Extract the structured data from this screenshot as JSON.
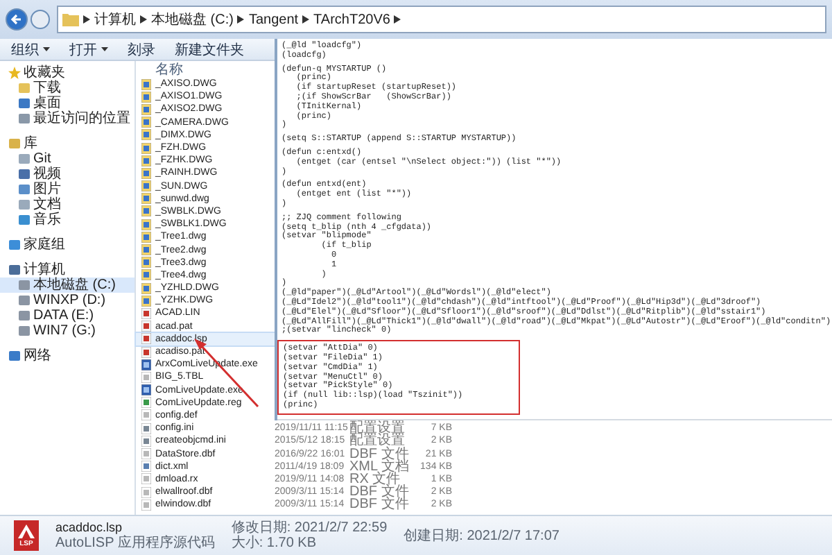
{
  "address": {
    "crumbs": [
      "计算机",
      "本地磁盘 (C:)",
      "Tangent",
      "TArchT20V6"
    ]
  },
  "toolbar": [
    {
      "label": "组织",
      "dropdown": true
    },
    {
      "label": "打开",
      "dropdown": true
    },
    {
      "label": "刻录",
      "dropdown": false
    },
    {
      "label": "新建文件夹",
      "dropdown": false
    }
  ],
  "nav": [
    {
      "label": "收藏夹",
      "kind": "star",
      "selected": false,
      "children": [
        {
          "label": "下载",
          "kind": "folder",
          "selected": false
        },
        {
          "label": "桌面",
          "kind": "screen",
          "selected": false
        },
        {
          "label": "最近访问的位置",
          "kind": "recent",
          "selected": false
        }
      ]
    },
    {
      "label": "库",
      "kind": "library",
      "selected": false,
      "children": [
        {
          "label": "Git",
          "kind": "document",
          "selected": false
        },
        {
          "label": "视频",
          "kind": "video",
          "selected": false
        },
        {
          "label": "图片",
          "kind": "picture",
          "selected": false
        },
        {
          "label": "文档",
          "kind": "document",
          "selected": false
        },
        {
          "label": "音乐",
          "kind": "music",
          "selected": false
        }
      ]
    },
    {
      "label": "家庭组",
      "kind": "people",
      "selected": false
    },
    {
      "label": "计算机",
      "kind": "computer",
      "selected": false,
      "children": [
        {
          "label": "本地磁盘 (C:)",
          "kind": "drive",
          "selected": true
        },
        {
          "label": "WINXP (D:)",
          "kind": "drive",
          "selected": false
        },
        {
          "label": "DATA (E:)",
          "kind": "drive",
          "selected": false
        },
        {
          "label": "WIN7 (G:)",
          "kind": "drive",
          "selected": false
        }
      ]
    },
    {
      "label": "网络",
      "kind": "network",
      "selected": false
    }
  ],
  "file_list": {
    "columns": [
      "名称"
    ],
    "rows": [
      {
        "name": "_AXISO.DWG",
        "kind": "drawing",
        "selected": false
      },
      {
        "name": "_AXISO1.DWG",
        "kind": "drawing",
        "selected": false
      },
      {
        "name": "_AXISO2.DWG",
        "kind": "drawing",
        "selected": false
      },
      {
        "name": "_CAMERA.DWG",
        "kind": "drawing",
        "selected": false
      },
      {
        "name": "_DIMX.DWG",
        "kind": "drawing",
        "selected": false
      },
      {
        "name": "_FZH.DWG",
        "kind": "drawing",
        "selected": false
      },
      {
        "name": "_FZHK.DWG",
        "kind": "drawing",
        "selected": false
      },
      {
        "name": "_RAINH.DWG",
        "kind": "drawing",
        "selected": false
      },
      {
        "name": "_SUN.DWG",
        "kind": "drawing",
        "selected": false
      },
      {
        "name": "_sunwd.dwg",
        "kind": "drawing",
        "selected": false
      },
      {
        "name": "_SWBLK.DWG",
        "kind": "drawing",
        "selected": false
      },
      {
        "name": "_SWBLK1.DWG",
        "kind": "drawing",
        "selected": false
      },
      {
        "name": "_Tree1.dwg",
        "kind": "drawing",
        "selected": false
      },
      {
        "name": "_Tree2.dwg",
        "kind": "drawing",
        "selected": false
      },
      {
        "name": "_Tree3.dwg",
        "kind": "drawing",
        "selected": false
      },
      {
        "name": "_Tree4.dwg",
        "kind": "drawing",
        "selected": false
      },
      {
        "name": "_YZHLD.DWG",
        "kind": "drawing",
        "selected": false
      },
      {
        "name": "_YZHK.DWG",
        "kind": "drawing",
        "selected": false
      },
      {
        "name": "ACAD.LIN",
        "kind": "acad",
        "selected": false
      },
      {
        "name": "acad.pat",
        "kind": "acad",
        "selected": false
      },
      {
        "name": "acaddoc.lsp",
        "kind": "lisp",
        "selected": true
      },
      {
        "name": "acadiso.pat",
        "kind": "acad",
        "selected": false
      },
      {
        "name": "ArxComLiveUpdate.exe",
        "kind": "app",
        "selected": false
      },
      {
        "name": "BIG_5.TBL",
        "kind": "doc",
        "selected": false
      },
      {
        "name": "ComLiveUpdate.exe",
        "kind": "app",
        "selected": false
      },
      {
        "name": "ComLiveUpdate.reg",
        "kind": "reg",
        "selected": false
      },
      {
        "name": "config.def",
        "kind": "doc",
        "selected": false
      },
      {
        "name": "config.ini",
        "kind": "settings",
        "selected": false,
        "date": "2019/11/11 11:15",
        "type": "配置设置",
        "size": "7 KB"
      },
      {
        "name": "createobjcmd.ini",
        "kind": "settings",
        "selected": false,
        "date": "2015/5/12 18:15",
        "type": "配置设置",
        "size": "2 KB"
      },
      {
        "name": "DataStore.dbf",
        "kind": "doc",
        "selected": false,
        "date": "2016/9/22 16:01",
        "type": "DBF 文件",
        "size": "21 KB"
      },
      {
        "name": "dict.xml",
        "kind": "xml",
        "selected": false,
        "date": "2011/4/19 18:09",
        "type": "XML 文档",
        "size": "134 KB"
      },
      {
        "name": "dmload.rx",
        "kind": "doc",
        "selected": false,
        "date": "2019/9/11 14:08",
        "type": "RX 文件",
        "size": "1 KB"
      },
      {
        "name": "elwallroof.dbf",
        "kind": "doc",
        "selected": false,
        "date": "2009/3/11 15:14",
        "type": "DBF 文件",
        "size": "2 KB"
      },
      {
        "name": "elwindow.dbf",
        "kind": "doc",
        "selected": false,
        "date": "2009/3/11 15:14",
        "type": "DBF 文件",
        "size": "2 KB"
      }
    ]
  },
  "editor": {
    "blocks": [
      {
        "highlighted": false,
        "lines": [
          "(_@ld \"loadcfg\")",
          "(loadcfg)"
        ]
      },
      {
        "highlighted": false,
        "lines": [
          "(defun-q MYSTARTUP ()",
          "   (princ)",
          "   (if startupReset (startupReset))",
          "   ;(if ShowScrBar   (ShowScrBar))",
          "   (TInitKernal)",
          "   (princ)",
          ")"
        ]
      },
      {
        "highlighted": false,
        "lines": [
          "(setq S::STARTUP (append S::STARTUP MYSTARTUP))"
        ]
      },
      {
        "highlighted": false,
        "lines": [
          "(defun c:entxd()",
          "   (entget (car (entsel \"\\nSelect object:\")) (list \"*\"))",
          ")"
        ]
      },
      {
        "highlighted": false,
        "lines": [
          "(defun entxd(ent)",
          "   (entget ent (list \"*\"))",
          ")"
        ]
      },
      {
        "highlighted": false,
        "lines": [
          ";; ZJQ comment following",
          "(setq t_blip (nth 4 _cfgdata))",
          "(setvar \"blipmode\"",
          "        (if t_blip",
          "          0",
          "          1",
          "        )",
          ")",
          "(_@ld\"paper\")(_@Ld\"Artool\")(_@Ld\"Wordsl\")(_@ld\"elect\")",
          "(_@Ld\"Idel2\")(_@ld\"tool1\")(_@ld\"chdash\")(_@ld\"intftool\")(_@Ld\"Proof\")(_@Ld\"Hip3d\")(_@Ld\"3droof\")",
          "(_@Ld\"Elel\")(_@Ld\"Sfloor\")(_@Ld\"Sfloor1\")(_@ld\"sroof\")(_@Ld\"Ddlst\")(_@Ld\"Ritplib\")(_@ld\"sstair1\")",
          "(_@Ld\"AllFill\")(_@Ld\"Thick1\")(_@ld\"dwall\")(_@ld\"road\")(_@Ld\"Mkpat\")(_@Ld\"Autostr\")(_@Ld\"Eroof\")(_@ld\"conditn\")",
          ";(setvar \"lincheck\" 0)"
        ]
      },
      {
        "highlighted": true,
        "lines": [
          "(setvar \"AttDia\" 0)",
          "(setvar \"FileDia\" 1)",
          "(setvar \"CmdDia\" 1)",
          "(setvar \"MenuCtl\" 0)",
          "(setvar \"PickStyle\" 0)",
          "(if (null lib::lsp)(load \"Tszinit\"))",
          "(princ)"
        ]
      }
    ]
  },
  "details": {
    "icon_label": "LSP",
    "name": "acaddoc.lsp",
    "type": "AutoLISP 应用程序源代码",
    "modified": "修改日期: 2021/2/7 22:59",
    "size": "大小: 1.70 KB",
    "created": "创建日期: 2021/2/7 17:07"
  }
}
